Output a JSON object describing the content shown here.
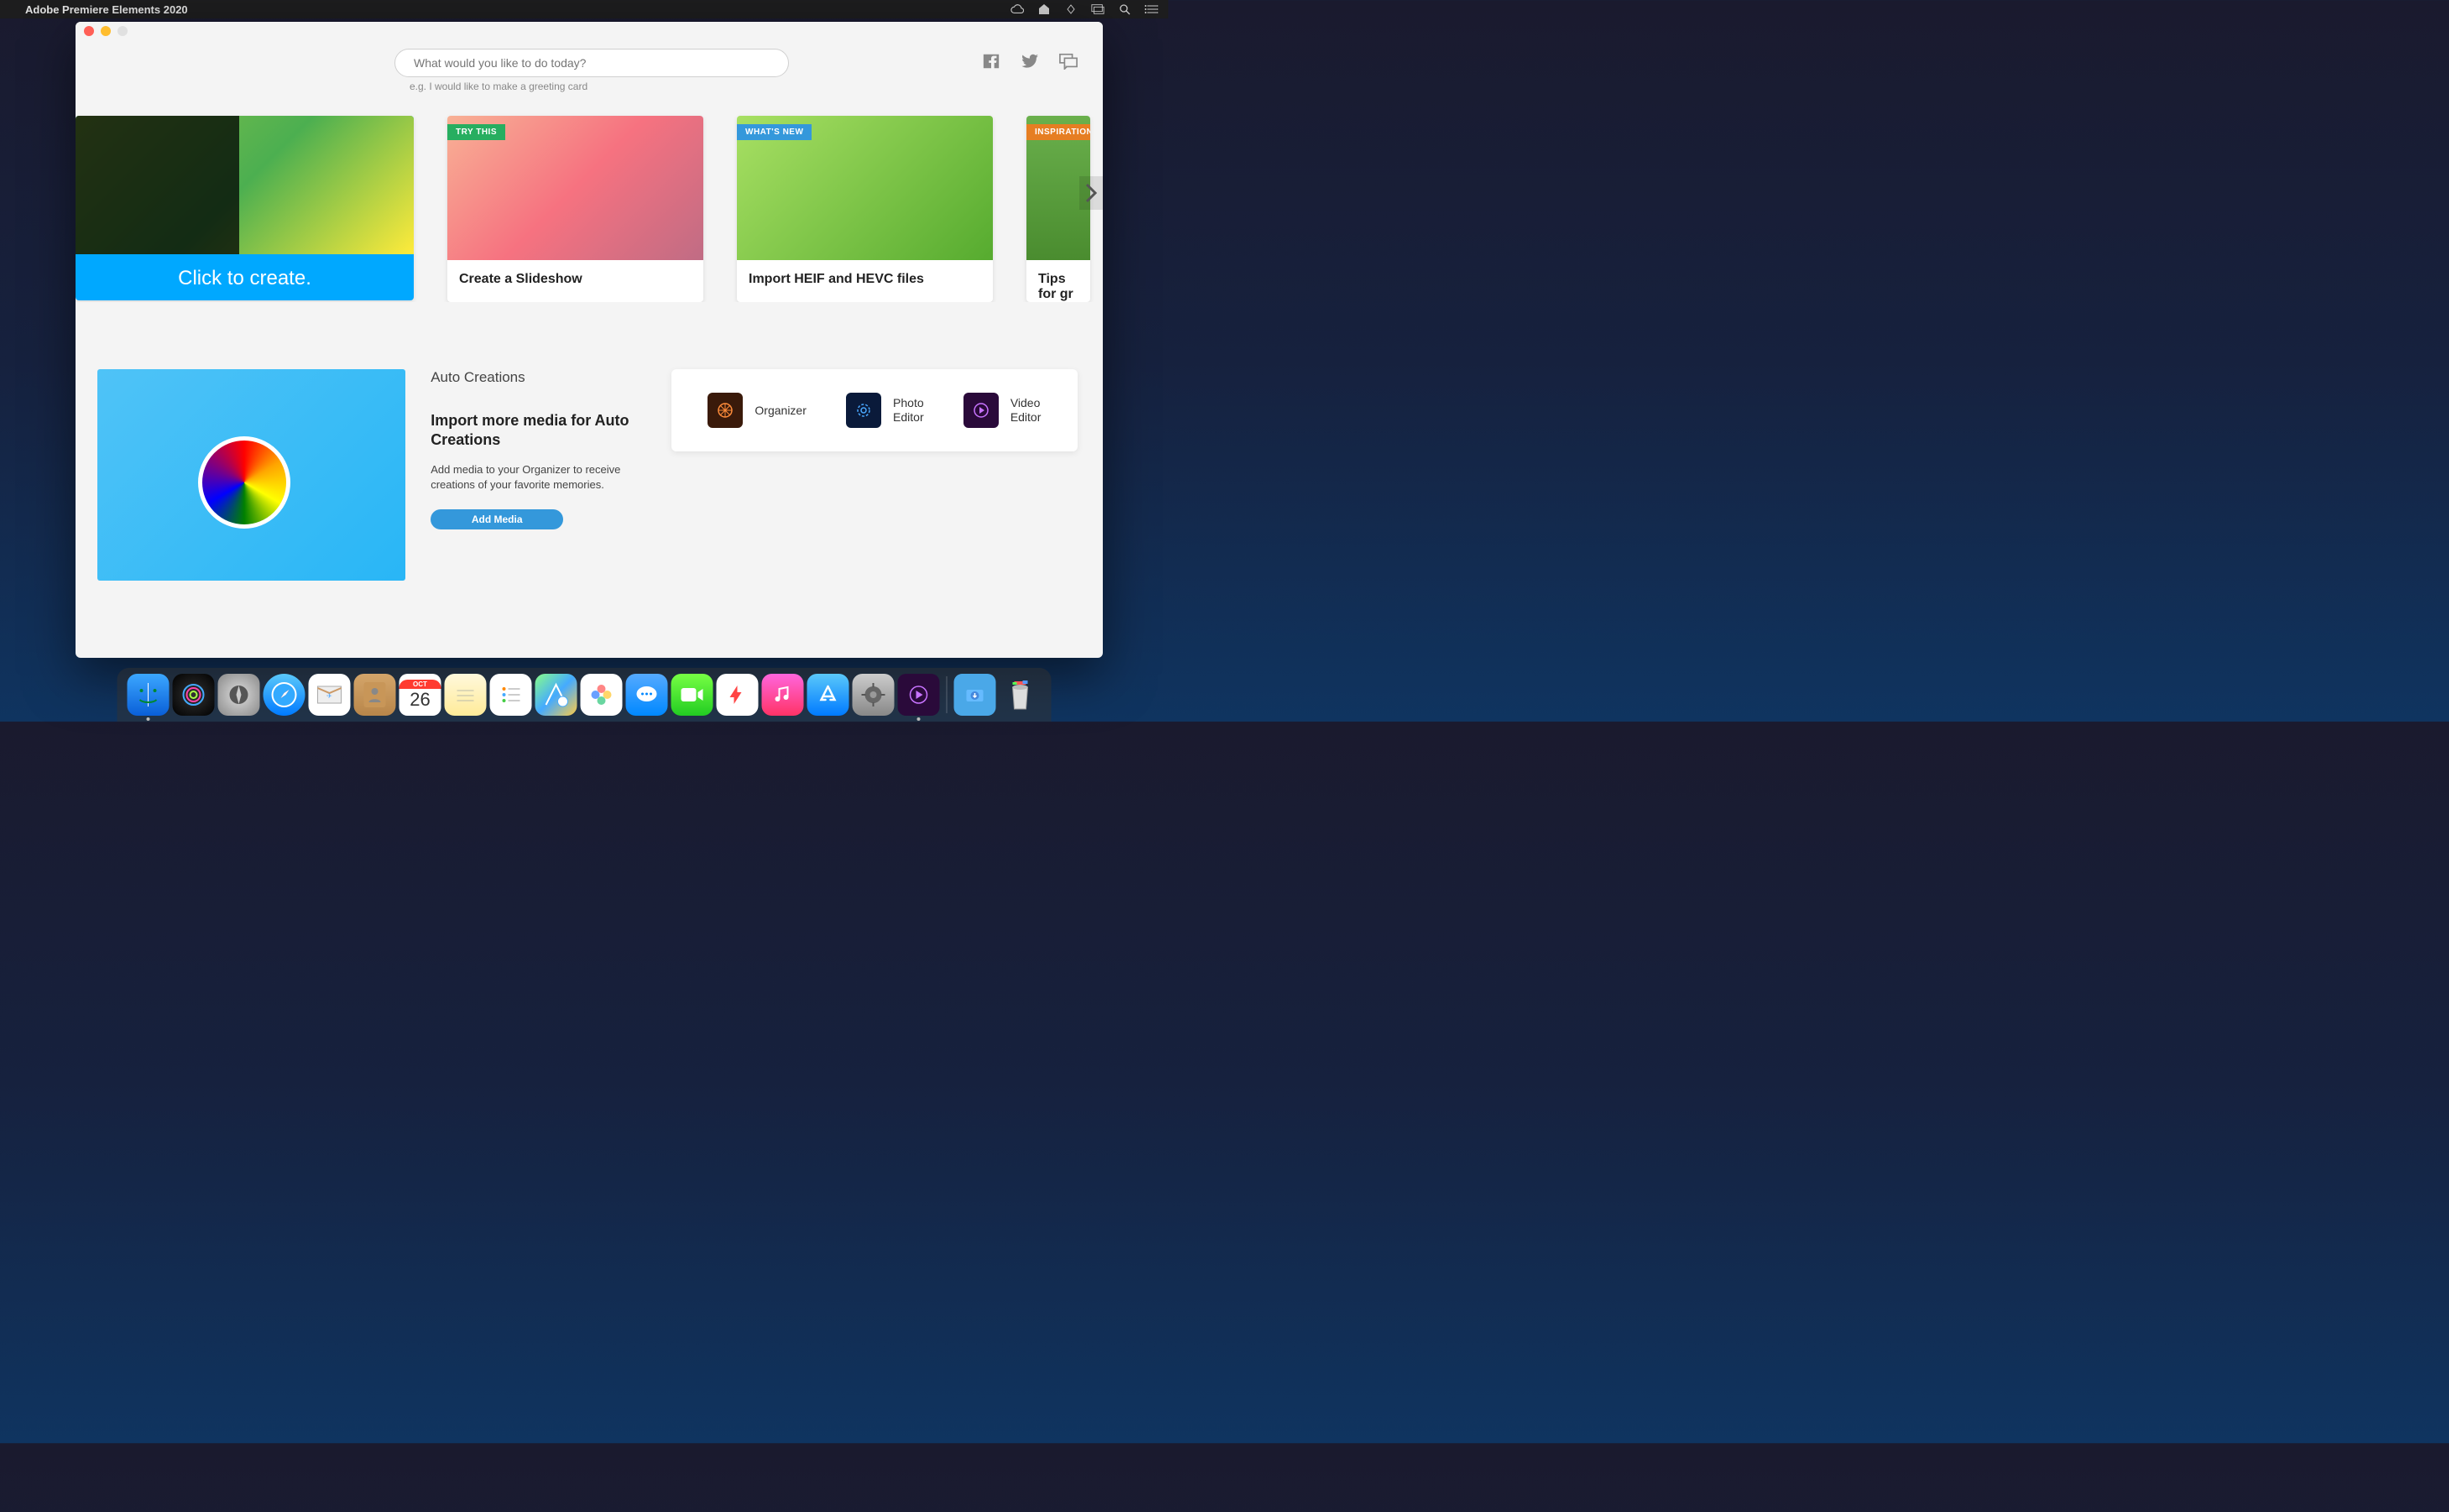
{
  "menubar": {
    "app_name": "Adobe Premiere Elements 2020"
  },
  "search": {
    "placeholder": "What would you like to do today?",
    "hint": "e.g. I would like to make a greeting card"
  },
  "cards": {
    "promo_text": "Click to create.",
    "slideshow": {
      "badge": "TRY THIS",
      "title": "Create a Slideshow"
    },
    "heif": {
      "badge": "WHAT'S NEW",
      "title": "Import HEIF and HEVC files"
    },
    "inspiration": {
      "badge": "INSPIRATION",
      "title": "Tips for gr"
    }
  },
  "auto": {
    "heading": "Auto Creations",
    "title": "Import more media for Auto Creations",
    "desc": "Add media to your Organizer to receive creations of your favorite memories.",
    "button": "Add Media"
  },
  "launchers": {
    "organizer": "Organizer",
    "photo": "Photo\nEditor",
    "video": "Video\nEditor"
  },
  "dock": {
    "cal_month": "OCT",
    "cal_day": "26"
  }
}
